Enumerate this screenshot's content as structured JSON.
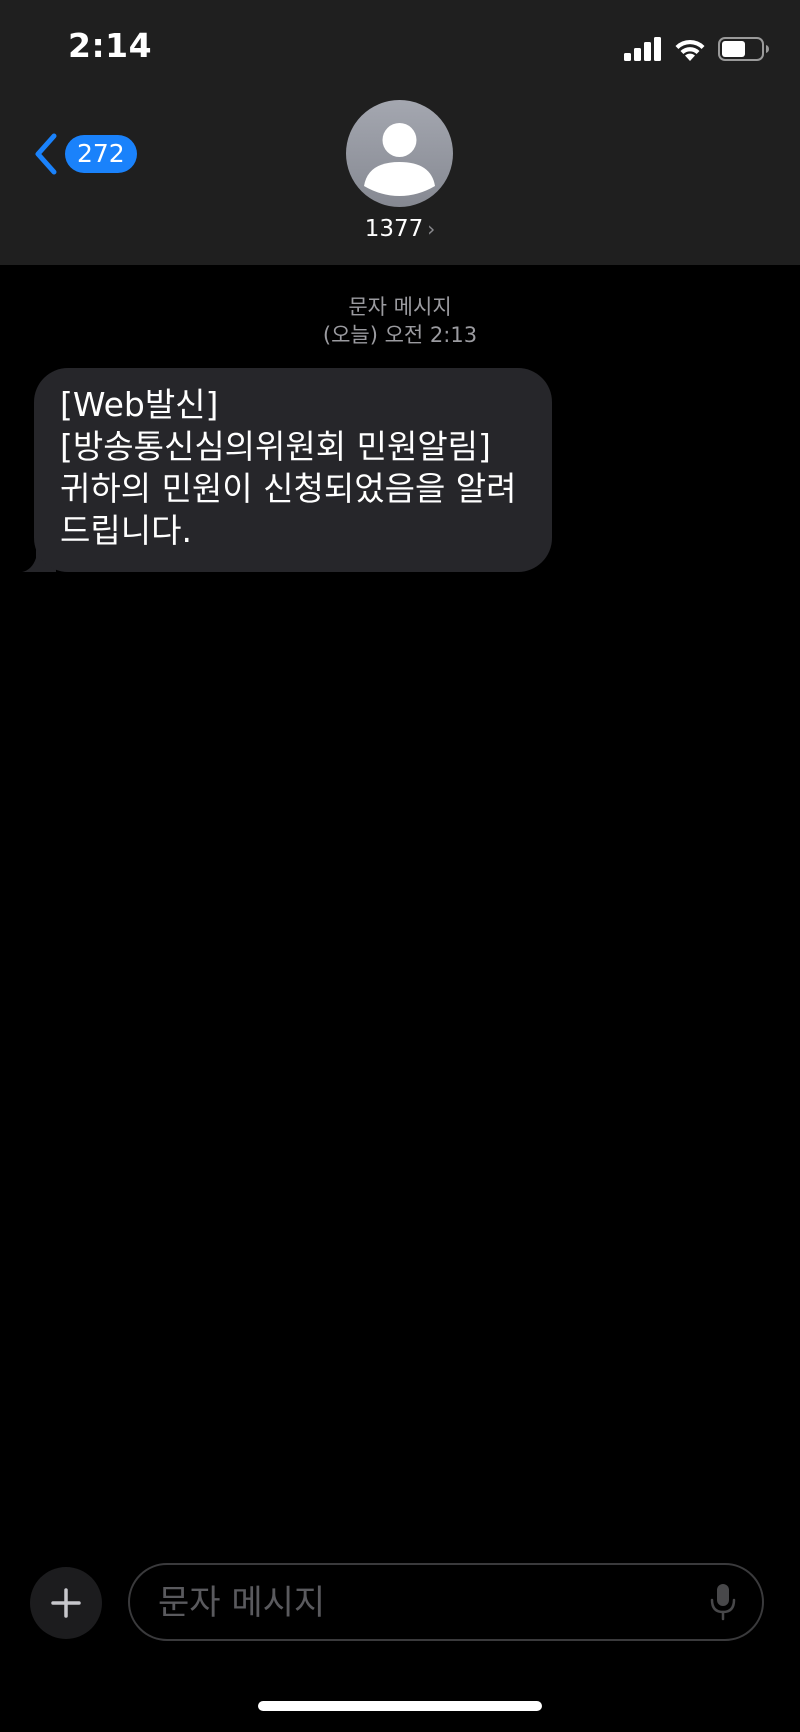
{
  "status_bar": {
    "time": "2:14",
    "icons": [
      "cellular-signal-icon",
      "wifi-icon",
      "battery-icon"
    ],
    "battery_level": 0.6
  },
  "header": {
    "back_count": "272",
    "contact_name": "1377",
    "contact_chevron": "›",
    "avatar_icon": "person-silhouette-icon"
  },
  "thread": {
    "channel_label": "문자 메시지",
    "timestamp": "(오늘) 오전 2:13"
  },
  "messages": [
    {
      "direction": "incoming",
      "text": "[Web발신]\n[방송통신심의위원회 민원알림]\n귀하의 민원이 신청되었음을 알려\n드립니다."
    }
  ],
  "composer": {
    "placeholder": "문자 메시지",
    "plus_icon": "plus-icon",
    "mic_icon": "microphone-icon"
  },
  "colors": {
    "accent_blue": "#1a82fb",
    "header_bg": "#1f1f1f",
    "bubble_bg": "#26262a",
    "meta_gray": "#9b9ba0"
  }
}
